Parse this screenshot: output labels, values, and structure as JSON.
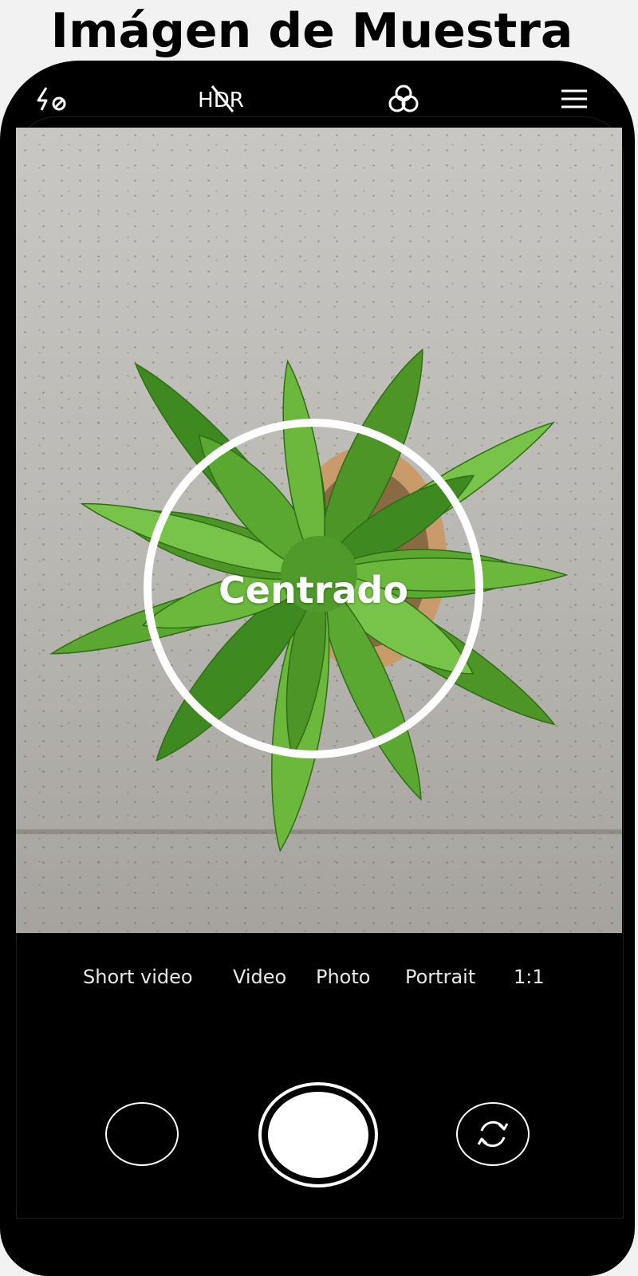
{
  "header": {
    "title": "Imágen de Muestra"
  },
  "topbar": {
    "icons": [
      "flash-off-icon",
      "hdr-off-icon",
      "filters-icon",
      "menu-icon"
    ],
    "hdr_label": "HDR"
  },
  "viewfinder": {
    "focus_label": "Centrado"
  },
  "modes": [
    "Short video",
    "Video",
    "Photo",
    "Portrait",
    "1:1"
  ],
  "colors": {
    "background": "#000000",
    "accent": "#ffffff"
  }
}
